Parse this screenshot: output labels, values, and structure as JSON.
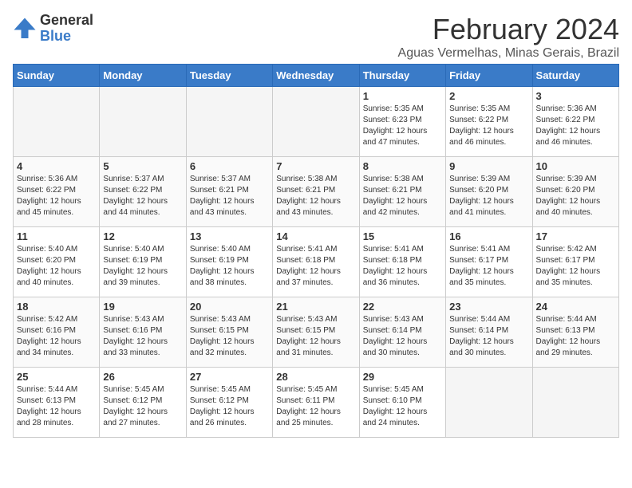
{
  "logo": {
    "general": "General",
    "blue": "Blue"
  },
  "title": {
    "month_year": "February 2024",
    "location": "Aguas Vermelhas, Minas Gerais, Brazil"
  },
  "days_of_week": [
    "Sunday",
    "Monday",
    "Tuesday",
    "Wednesday",
    "Thursday",
    "Friday",
    "Saturday"
  ],
  "weeks": [
    [
      {
        "day": "",
        "empty": true
      },
      {
        "day": "",
        "empty": true
      },
      {
        "day": "",
        "empty": true
      },
      {
        "day": "",
        "empty": true
      },
      {
        "day": "1",
        "sunrise": "Sunrise: 5:35 AM",
        "sunset": "Sunset: 6:23 PM",
        "daylight": "Daylight: 12 hours and 47 minutes."
      },
      {
        "day": "2",
        "sunrise": "Sunrise: 5:35 AM",
        "sunset": "Sunset: 6:22 PM",
        "daylight": "Daylight: 12 hours and 46 minutes."
      },
      {
        "day": "3",
        "sunrise": "Sunrise: 5:36 AM",
        "sunset": "Sunset: 6:22 PM",
        "daylight": "Daylight: 12 hours and 46 minutes."
      }
    ],
    [
      {
        "day": "4",
        "sunrise": "Sunrise: 5:36 AM",
        "sunset": "Sunset: 6:22 PM",
        "daylight": "Daylight: 12 hours and 45 minutes."
      },
      {
        "day": "5",
        "sunrise": "Sunrise: 5:37 AM",
        "sunset": "Sunset: 6:22 PM",
        "daylight": "Daylight: 12 hours and 44 minutes."
      },
      {
        "day": "6",
        "sunrise": "Sunrise: 5:37 AM",
        "sunset": "Sunset: 6:21 PM",
        "daylight": "Daylight: 12 hours and 43 minutes."
      },
      {
        "day": "7",
        "sunrise": "Sunrise: 5:38 AM",
        "sunset": "Sunset: 6:21 PM",
        "daylight": "Daylight: 12 hours and 43 minutes."
      },
      {
        "day": "8",
        "sunrise": "Sunrise: 5:38 AM",
        "sunset": "Sunset: 6:21 PM",
        "daylight": "Daylight: 12 hours and 42 minutes."
      },
      {
        "day": "9",
        "sunrise": "Sunrise: 5:39 AM",
        "sunset": "Sunset: 6:20 PM",
        "daylight": "Daylight: 12 hours and 41 minutes."
      },
      {
        "day": "10",
        "sunrise": "Sunrise: 5:39 AM",
        "sunset": "Sunset: 6:20 PM",
        "daylight": "Daylight: 12 hours and 40 minutes."
      }
    ],
    [
      {
        "day": "11",
        "sunrise": "Sunrise: 5:40 AM",
        "sunset": "Sunset: 6:20 PM",
        "daylight": "Daylight: 12 hours and 40 minutes."
      },
      {
        "day": "12",
        "sunrise": "Sunrise: 5:40 AM",
        "sunset": "Sunset: 6:19 PM",
        "daylight": "Daylight: 12 hours and 39 minutes."
      },
      {
        "day": "13",
        "sunrise": "Sunrise: 5:40 AM",
        "sunset": "Sunset: 6:19 PM",
        "daylight": "Daylight: 12 hours and 38 minutes."
      },
      {
        "day": "14",
        "sunrise": "Sunrise: 5:41 AM",
        "sunset": "Sunset: 6:18 PM",
        "daylight": "Daylight: 12 hours and 37 minutes."
      },
      {
        "day": "15",
        "sunrise": "Sunrise: 5:41 AM",
        "sunset": "Sunset: 6:18 PM",
        "daylight": "Daylight: 12 hours and 36 minutes."
      },
      {
        "day": "16",
        "sunrise": "Sunrise: 5:41 AM",
        "sunset": "Sunset: 6:17 PM",
        "daylight": "Daylight: 12 hours and 35 minutes."
      },
      {
        "day": "17",
        "sunrise": "Sunrise: 5:42 AM",
        "sunset": "Sunset: 6:17 PM",
        "daylight": "Daylight: 12 hours and 35 minutes."
      }
    ],
    [
      {
        "day": "18",
        "sunrise": "Sunrise: 5:42 AM",
        "sunset": "Sunset: 6:16 PM",
        "daylight": "Daylight: 12 hours and 34 minutes."
      },
      {
        "day": "19",
        "sunrise": "Sunrise: 5:43 AM",
        "sunset": "Sunset: 6:16 PM",
        "daylight": "Daylight: 12 hours and 33 minutes."
      },
      {
        "day": "20",
        "sunrise": "Sunrise: 5:43 AM",
        "sunset": "Sunset: 6:15 PM",
        "daylight": "Daylight: 12 hours and 32 minutes."
      },
      {
        "day": "21",
        "sunrise": "Sunrise: 5:43 AM",
        "sunset": "Sunset: 6:15 PM",
        "daylight": "Daylight: 12 hours and 31 minutes."
      },
      {
        "day": "22",
        "sunrise": "Sunrise: 5:43 AM",
        "sunset": "Sunset: 6:14 PM",
        "daylight": "Daylight: 12 hours and 30 minutes."
      },
      {
        "day": "23",
        "sunrise": "Sunrise: 5:44 AM",
        "sunset": "Sunset: 6:14 PM",
        "daylight": "Daylight: 12 hours and 30 minutes."
      },
      {
        "day": "24",
        "sunrise": "Sunrise: 5:44 AM",
        "sunset": "Sunset: 6:13 PM",
        "daylight": "Daylight: 12 hours and 29 minutes."
      }
    ],
    [
      {
        "day": "25",
        "sunrise": "Sunrise: 5:44 AM",
        "sunset": "Sunset: 6:13 PM",
        "daylight": "Daylight: 12 hours and 28 minutes."
      },
      {
        "day": "26",
        "sunrise": "Sunrise: 5:45 AM",
        "sunset": "Sunset: 6:12 PM",
        "daylight": "Daylight: 12 hours and 27 minutes."
      },
      {
        "day": "27",
        "sunrise": "Sunrise: 5:45 AM",
        "sunset": "Sunset: 6:12 PM",
        "daylight": "Daylight: 12 hours and 26 minutes."
      },
      {
        "day": "28",
        "sunrise": "Sunrise: 5:45 AM",
        "sunset": "Sunset: 6:11 PM",
        "daylight": "Daylight: 12 hours and 25 minutes."
      },
      {
        "day": "29",
        "sunrise": "Sunrise: 5:45 AM",
        "sunset": "Sunset: 6:10 PM",
        "daylight": "Daylight: 12 hours and 24 minutes."
      },
      {
        "day": "",
        "empty": true
      },
      {
        "day": "",
        "empty": true
      }
    ]
  ]
}
